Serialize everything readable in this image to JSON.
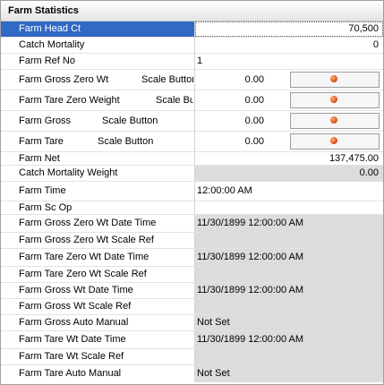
{
  "panel": {
    "title": "Farm Statistics"
  },
  "rows": [
    {
      "label": "Farm Head Ct",
      "value": "70,500"
    },
    {
      "label": "Catch Mortality",
      "value": "0"
    },
    {
      "label": "Farm Ref No",
      "value": "1"
    },
    {
      "label": "Farm Gross Zero Wt",
      "sublabel": "Scale Button",
      "value": "0.00"
    },
    {
      "label": "Farm Tare Zero Weight",
      "sublabel": "Scale Button",
      "value": "0.00"
    },
    {
      "label": "Farm Gross",
      "sublabel": "Scale Button",
      "value": "0.00"
    },
    {
      "label": "Farm Tare",
      "sublabel": "Scale Button",
      "value": "0.00"
    },
    {
      "label": "Farm Net",
      "value": "137,475.00"
    },
    {
      "label": "Catch Mortality Weight",
      "value": "0.00"
    },
    {
      "label": "Farm Time",
      "value": "12:00:00 AM"
    },
    {
      "label": "Farm Sc Op",
      "value": ""
    },
    {
      "label": "Farm Gross Zero Wt Date Time",
      "value": "11/30/1899 12:00:00 AM"
    },
    {
      "label": "Farm Gross Zero Wt Scale Ref",
      "value": ""
    },
    {
      "label": "Farm Tare Zero Wt Date Time",
      "value": "11/30/1899 12:00:00 AM"
    },
    {
      "label": "Farm Tare Zero Wt Scale Ref",
      "value": ""
    },
    {
      "label": "Farm Gross Wt Date Time",
      "value": "11/30/1899 12:00:00 AM"
    },
    {
      "label": "Farm Gross Wt Scale Ref",
      "value": ""
    },
    {
      "label": "Farm Gross Auto Manual",
      "value": "Not Set"
    },
    {
      "label": "Farm Tare Wt Date Time",
      "value": "11/30/1899 12:00:00 AM"
    },
    {
      "label": "Farm Tare Wt Scale Ref",
      "value": ""
    },
    {
      "label": "Farm Tare Auto Manual",
      "value": "Not Set"
    }
  ],
  "colors": {
    "selection": "#3169c6",
    "readonly_bg": "#dcdcdc",
    "indicator": "#e0561a"
  }
}
